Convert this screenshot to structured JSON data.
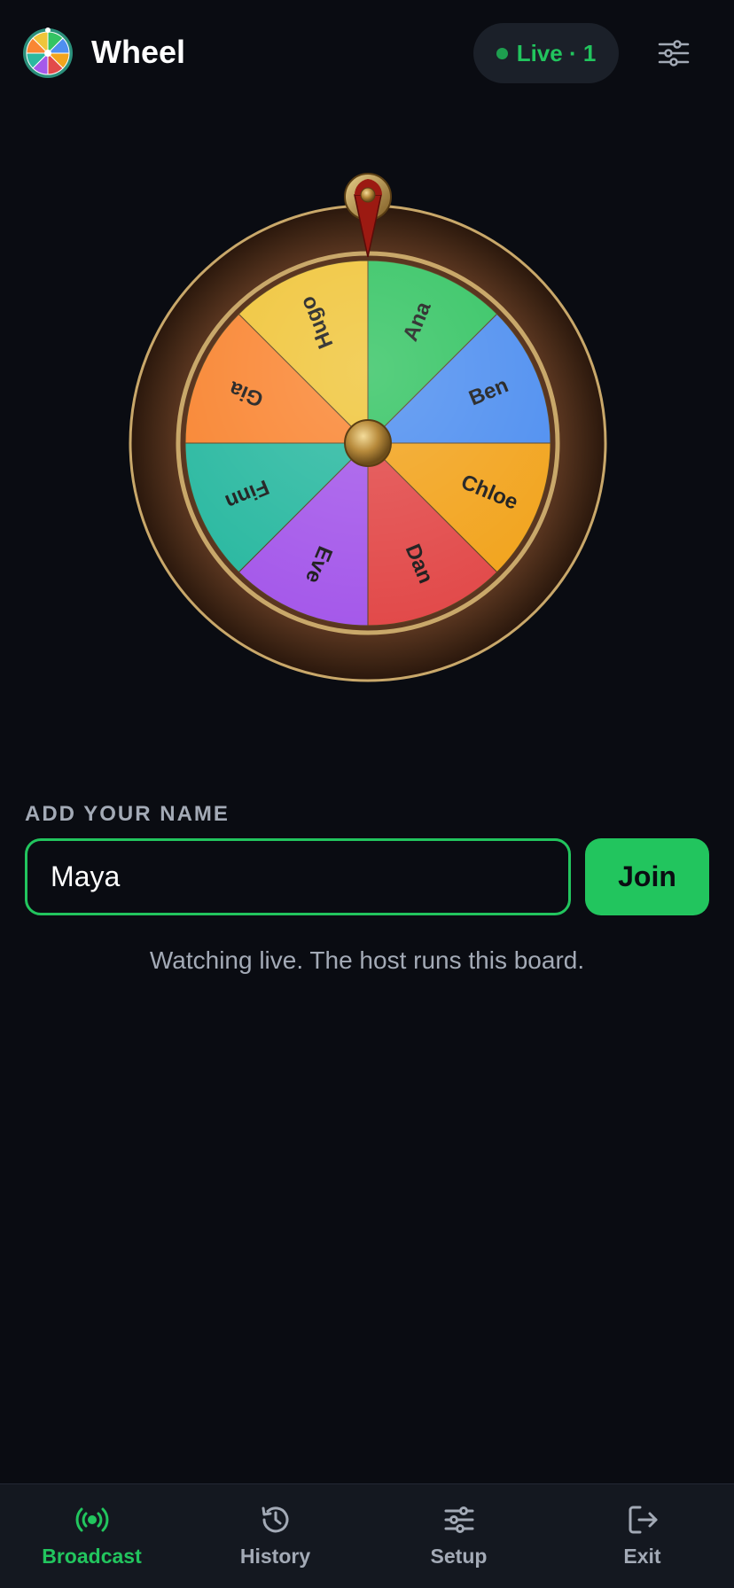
{
  "header": {
    "title": "Wheel",
    "live_label": "Live · 1",
    "logo_icon": "wheel-logo-icon",
    "settings_icon": "sliders-icon"
  },
  "wheel": {
    "segments": [
      {
        "label": "Ana",
        "color": "#34c463"
      },
      {
        "label": "Ben",
        "color": "#4f8ff0"
      },
      {
        "label": "Chloe",
        "color": "#f2a41e"
      },
      {
        "label": "Dan",
        "color": "#e24a4a"
      },
      {
        "label": "Eve",
        "color": "#a559ea"
      },
      {
        "label": "Finn",
        "color": "#2bb9a1"
      },
      {
        "label": "Gia",
        "color": "#f98633"
      },
      {
        "label": "Hugo",
        "color": "#f0c53a"
      }
    ]
  },
  "form": {
    "label": "ADD YOUR NAME",
    "input_value": "Maya",
    "join_label": "Join",
    "status": "Watching live. The host runs this board."
  },
  "nav": [
    {
      "label": "Broadcast",
      "icon": "broadcast-icon",
      "active": true
    },
    {
      "label": "History",
      "icon": "history-icon",
      "active": false
    },
    {
      "label": "Setup",
      "icon": "sliders-icon",
      "active": false
    },
    {
      "label": "Exit",
      "icon": "exit-icon",
      "active": false
    }
  ],
  "colors": {
    "accent": "#22c55e",
    "background": "#0a0c12",
    "muted_text": "#a3aab6",
    "pointer": "#9c1a12",
    "rim_gold": "#c9a86a"
  }
}
